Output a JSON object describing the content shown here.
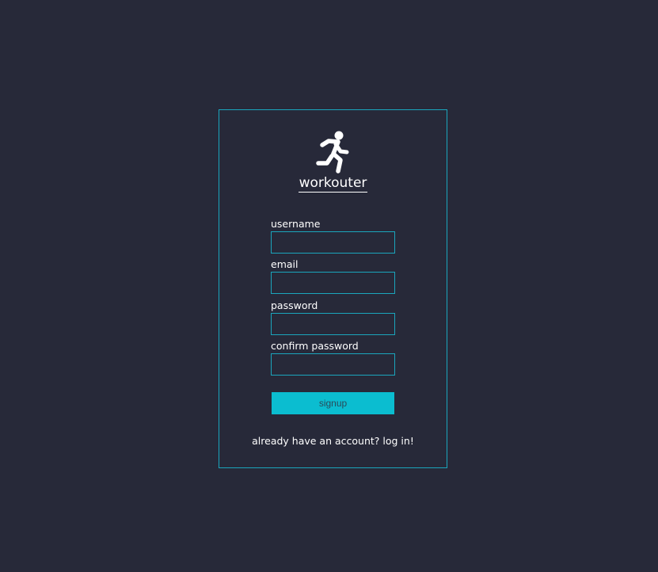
{
  "app": {
    "name": "workouter",
    "logo_icon": "running-person-icon"
  },
  "form": {
    "fields": [
      {
        "label": "username",
        "value": "",
        "type": "text"
      },
      {
        "label": "email",
        "value": "",
        "type": "email"
      },
      {
        "label": "password",
        "value": "",
        "type": "password"
      },
      {
        "label": "confirm password",
        "value": "",
        "type": "password"
      }
    ],
    "submit_label": "signup",
    "login_link": "already have an account? log in!"
  },
  "colors": {
    "background": "#272939",
    "accent": "#1aa6bd",
    "button": "#0bbdd0",
    "text": "#ffffff"
  }
}
